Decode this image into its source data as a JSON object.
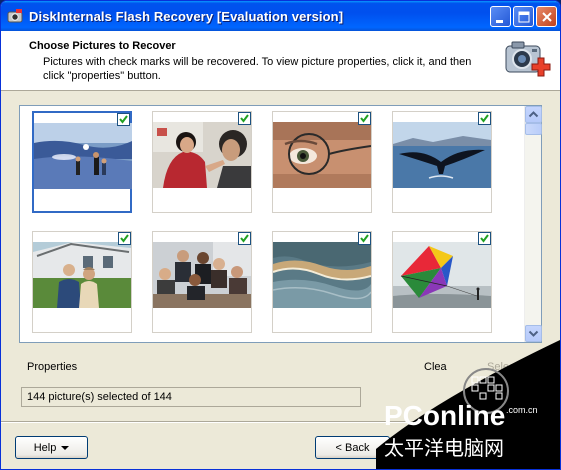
{
  "window": {
    "title": "DiskInternals Flash Recovery [Evaluation version]"
  },
  "header": {
    "title": "Choose Pictures to Recover",
    "description": "Pictures with check marks will be recovered. To view picture properties, click it, and then click \"properties\" button."
  },
  "gallery": {
    "thumbnails": [
      {
        "subject": "beach-people",
        "checked": true,
        "selected": true
      },
      {
        "subject": "woman-presenting",
        "checked": true,
        "selected": false
      },
      {
        "subject": "eye-glasses",
        "checked": true,
        "selected": false
      },
      {
        "subject": "whale-tail",
        "checked": true,
        "selected": false
      },
      {
        "subject": "couple-house",
        "checked": true,
        "selected": false
      },
      {
        "subject": "business-meeting",
        "checked": true,
        "selected": false
      },
      {
        "subject": "ocean-wave",
        "checked": true,
        "selected": false
      },
      {
        "subject": "kite",
        "checked": true,
        "selected": false
      }
    ]
  },
  "footer": {
    "properties_label": "Properties",
    "clear_label": "Clea",
    "select_label": "Select",
    "status_text": "144 picture(s) selected of 144",
    "help_label": "Help",
    "back_label": "< Back"
  },
  "watermark": {
    "brand": "PConline",
    "domain": ".com.cn",
    "chinese": "太平洋电脑网"
  },
  "colors": {
    "titlebar": "#0053ee",
    "window_bg": "#ece9d8",
    "selection": "#316ac5",
    "checkmark": "#21a121"
  }
}
